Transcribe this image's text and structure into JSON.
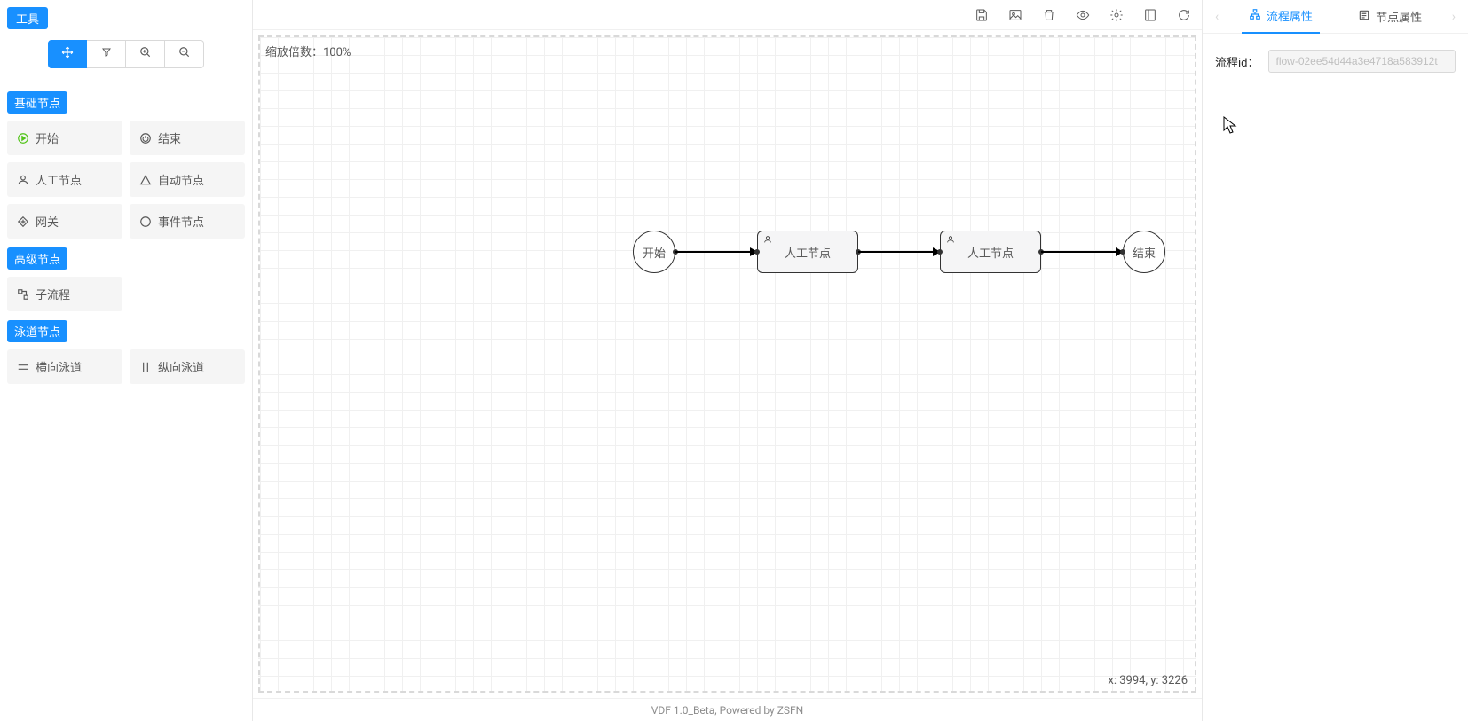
{
  "sidebar": {
    "tools_label": "工具",
    "sections": {
      "basic": {
        "title": "基础节点",
        "items": [
          {
            "label": "开始",
            "icon": "play-circle"
          },
          {
            "label": "结束",
            "icon": "power"
          },
          {
            "label": "人工节点",
            "icon": "user"
          },
          {
            "label": "自动节点",
            "icon": "triangle"
          },
          {
            "label": "网关",
            "icon": "diamond"
          },
          {
            "label": "事件节点",
            "icon": "circle"
          }
        ]
      },
      "advanced": {
        "title": "高级节点",
        "items": [
          {
            "label": "子流程",
            "icon": "subflow"
          }
        ]
      },
      "swimlane": {
        "title": "泳道节点",
        "items": [
          {
            "label": "横向泳道",
            "icon": "h-lines"
          },
          {
            "label": "纵向泳道",
            "icon": "v-lines"
          }
        ]
      }
    }
  },
  "canvas": {
    "zoom_label": "缩放倍数：100%",
    "coords": "x: 3994, y: 3226",
    "nodes": {
      "start": "开始",
      "manual1": "人工节点",
      "manual2": "人工节点",
      "end": "结束"
    }
  },
  "footer": "VDF 1.0_Beta, Powered by ZSFN",
  "rightPanel": {
    "tabs": {
      "flow": "流程属性",
      "node": "节点属性"
    },
    "flowId": {
      "label": "流程id：",
      "value": "flow-02ee54d44a3e4718a583912t"
    }
  }
}
